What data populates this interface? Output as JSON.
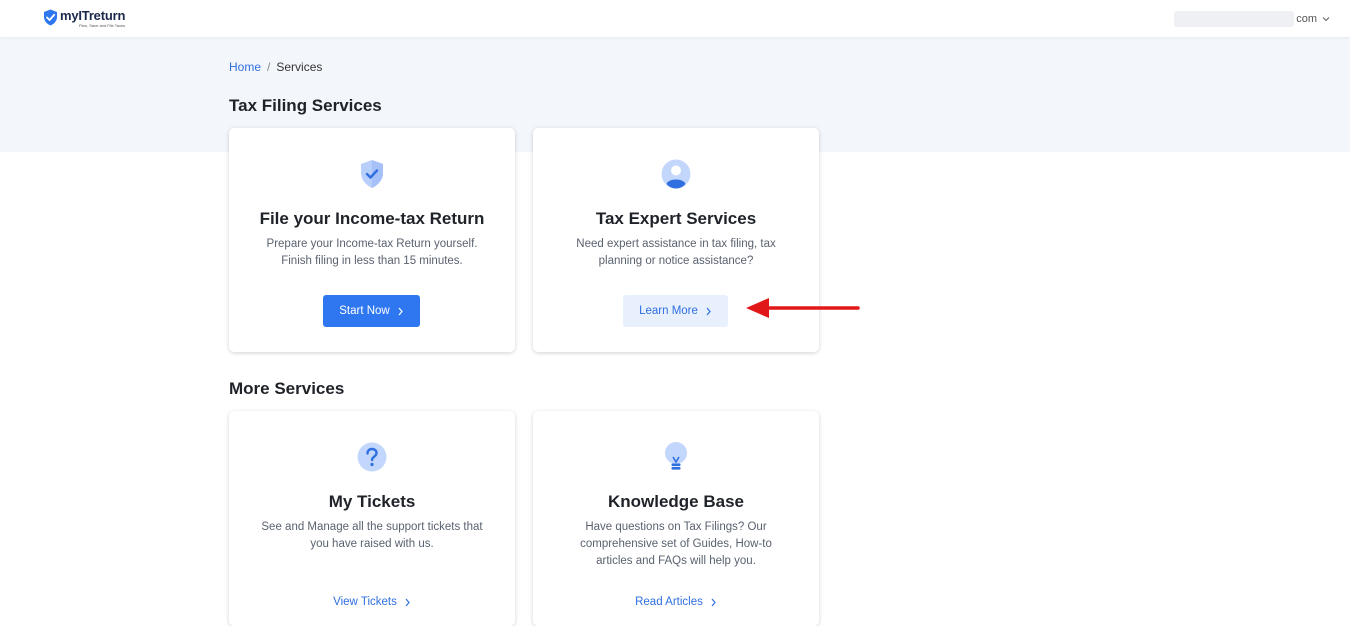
{
  "header": {
    "logo_name": "myITreturn",
    "logo_tagline": "Plan, Save and File Taxes",
    "user_domain": "com"
  },
  "breadcrumb": {
    "home": "Home",
    "separator": "/",
    "current": "Services"
  },
  "sections": {
    "tax_filing": {
      "title": "Tax Filing Services",
      "cards": [
        {
          "icon": "shield-check-icon",
          "title": "File your Income-tax Return",
          "desc_line1": "Prepare your Income-tax Return yourself.",
          "desc_line2": "Finish filing in less than 15 minutes.",
          "button": "Start Now"
        },
        {
          "icon": "user-avatar-icon",
          "title": "Tax Expert Services",
          "desc_line1": "Need expert assistance in tax filing, tax",
          "desc_line2": "planning or notice assistance?",
          "button": "Learn More"
        }
      ]
    },
    "more": {
      "title": "More Services",
      "cards": [
        {
          "icon": "question-icon",
          "title": "My Tickets",
          "desc_line1": "See and Manage all the support tickets that",
          "desc_line2": "you have raised with us.",
          "link": "View Tickets"
        },
        {
          "icon": "lightbulb-icon",
          "title": "Knowledge Base",
          "desc_line1": "Have questions on Tax Filings? Our",
          "desc_line2": "comprehensive set of Guides, How-to",
          "desc_line3": "articles and FAQs will help you.",
          "link": "Read Articles"
        }
      ]
    }
  },
  "colors": {
    "accent": "#2f77f0",
    "link": "#2f6fe0",
    "hero_bg": "#f3f6fb",
    "annotation_arrow": "#e01818"
  }
}
